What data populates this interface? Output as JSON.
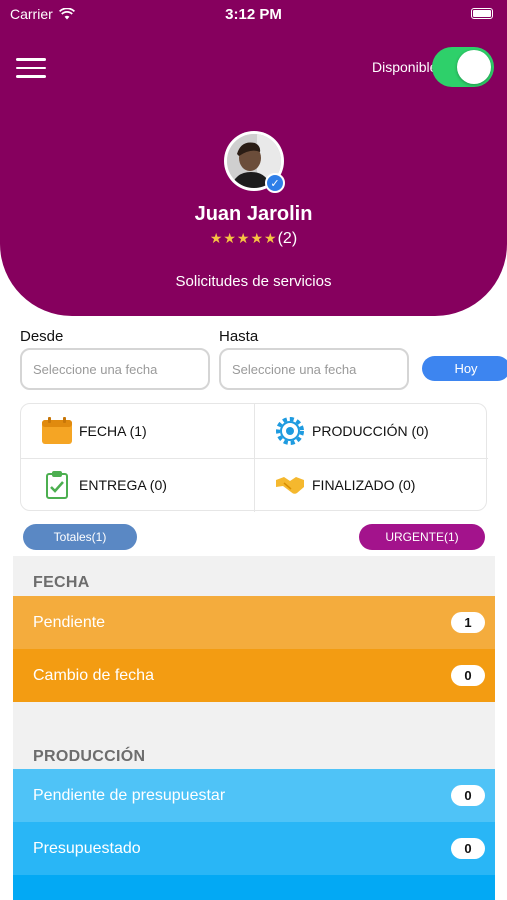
{
  "status_bar": {
    "carrier": "Carrier",
    "time": "3:12 PM"
  },
  "header": {
    "availability_label": "Disponible",
    "availability_on": true,
    "user_name": "Juan Jarolin",
    "stars": "★★★★★",
    "rating_count": "(2)",
    "subtitle": "Solicitudes de servicios",
    "brand_color": "#86005e"
  },
  "filters": {
    "from_label": "Desde",
    "to_label": "Hasta",
    "from_placeholder": "Seleccione una fecha",
    "to_placeholder": "Seleccione una fecha",
    "today_button": "Hoy"
  },
  "categories": [
    {
      "label": "FECHA (1)",
      "icon": "calendar-icon"
    },
    {
      "label": "PRODUCCIÓN (0)",
      "icon": "gear-icon"
    },
    {
      "label": "ENTREGA (0)",
      "icon": "clipboard-check-icon"
    },
    {
      "label": "FINALIZADO (0)",
      "icon": "handshake-icon"
    }
  ],
  "pills": {
    "totals": "Totales(1)",
    "urgent": "URGENTE(1)"
  },
  "sections": [
    {
      "title": "FECHA",
      "rows": [
        {
          "label": "Pendiente",
          "count": "1",
          "color": "#f4ac3d"
        },
        {
          "label": "Cambio de fecha",
          "count": "0",
          "color": "#f39c12"
        }
      ]
    },
    {
      "title": "PRODUCCIÓN",
      "rows": [
        {
          "label": "Pendiente de presupuestar",
          "count": "0",
          "color": "#4fc3f7"
        },
        {
          "label": "Presupuestado",
          "count": "0",
          "color": "#29b6f6"
        },
        {
          "label": "",
          "count": "",
          "color": "#03a9f4"
        }
      ]
    }
  ]
}
